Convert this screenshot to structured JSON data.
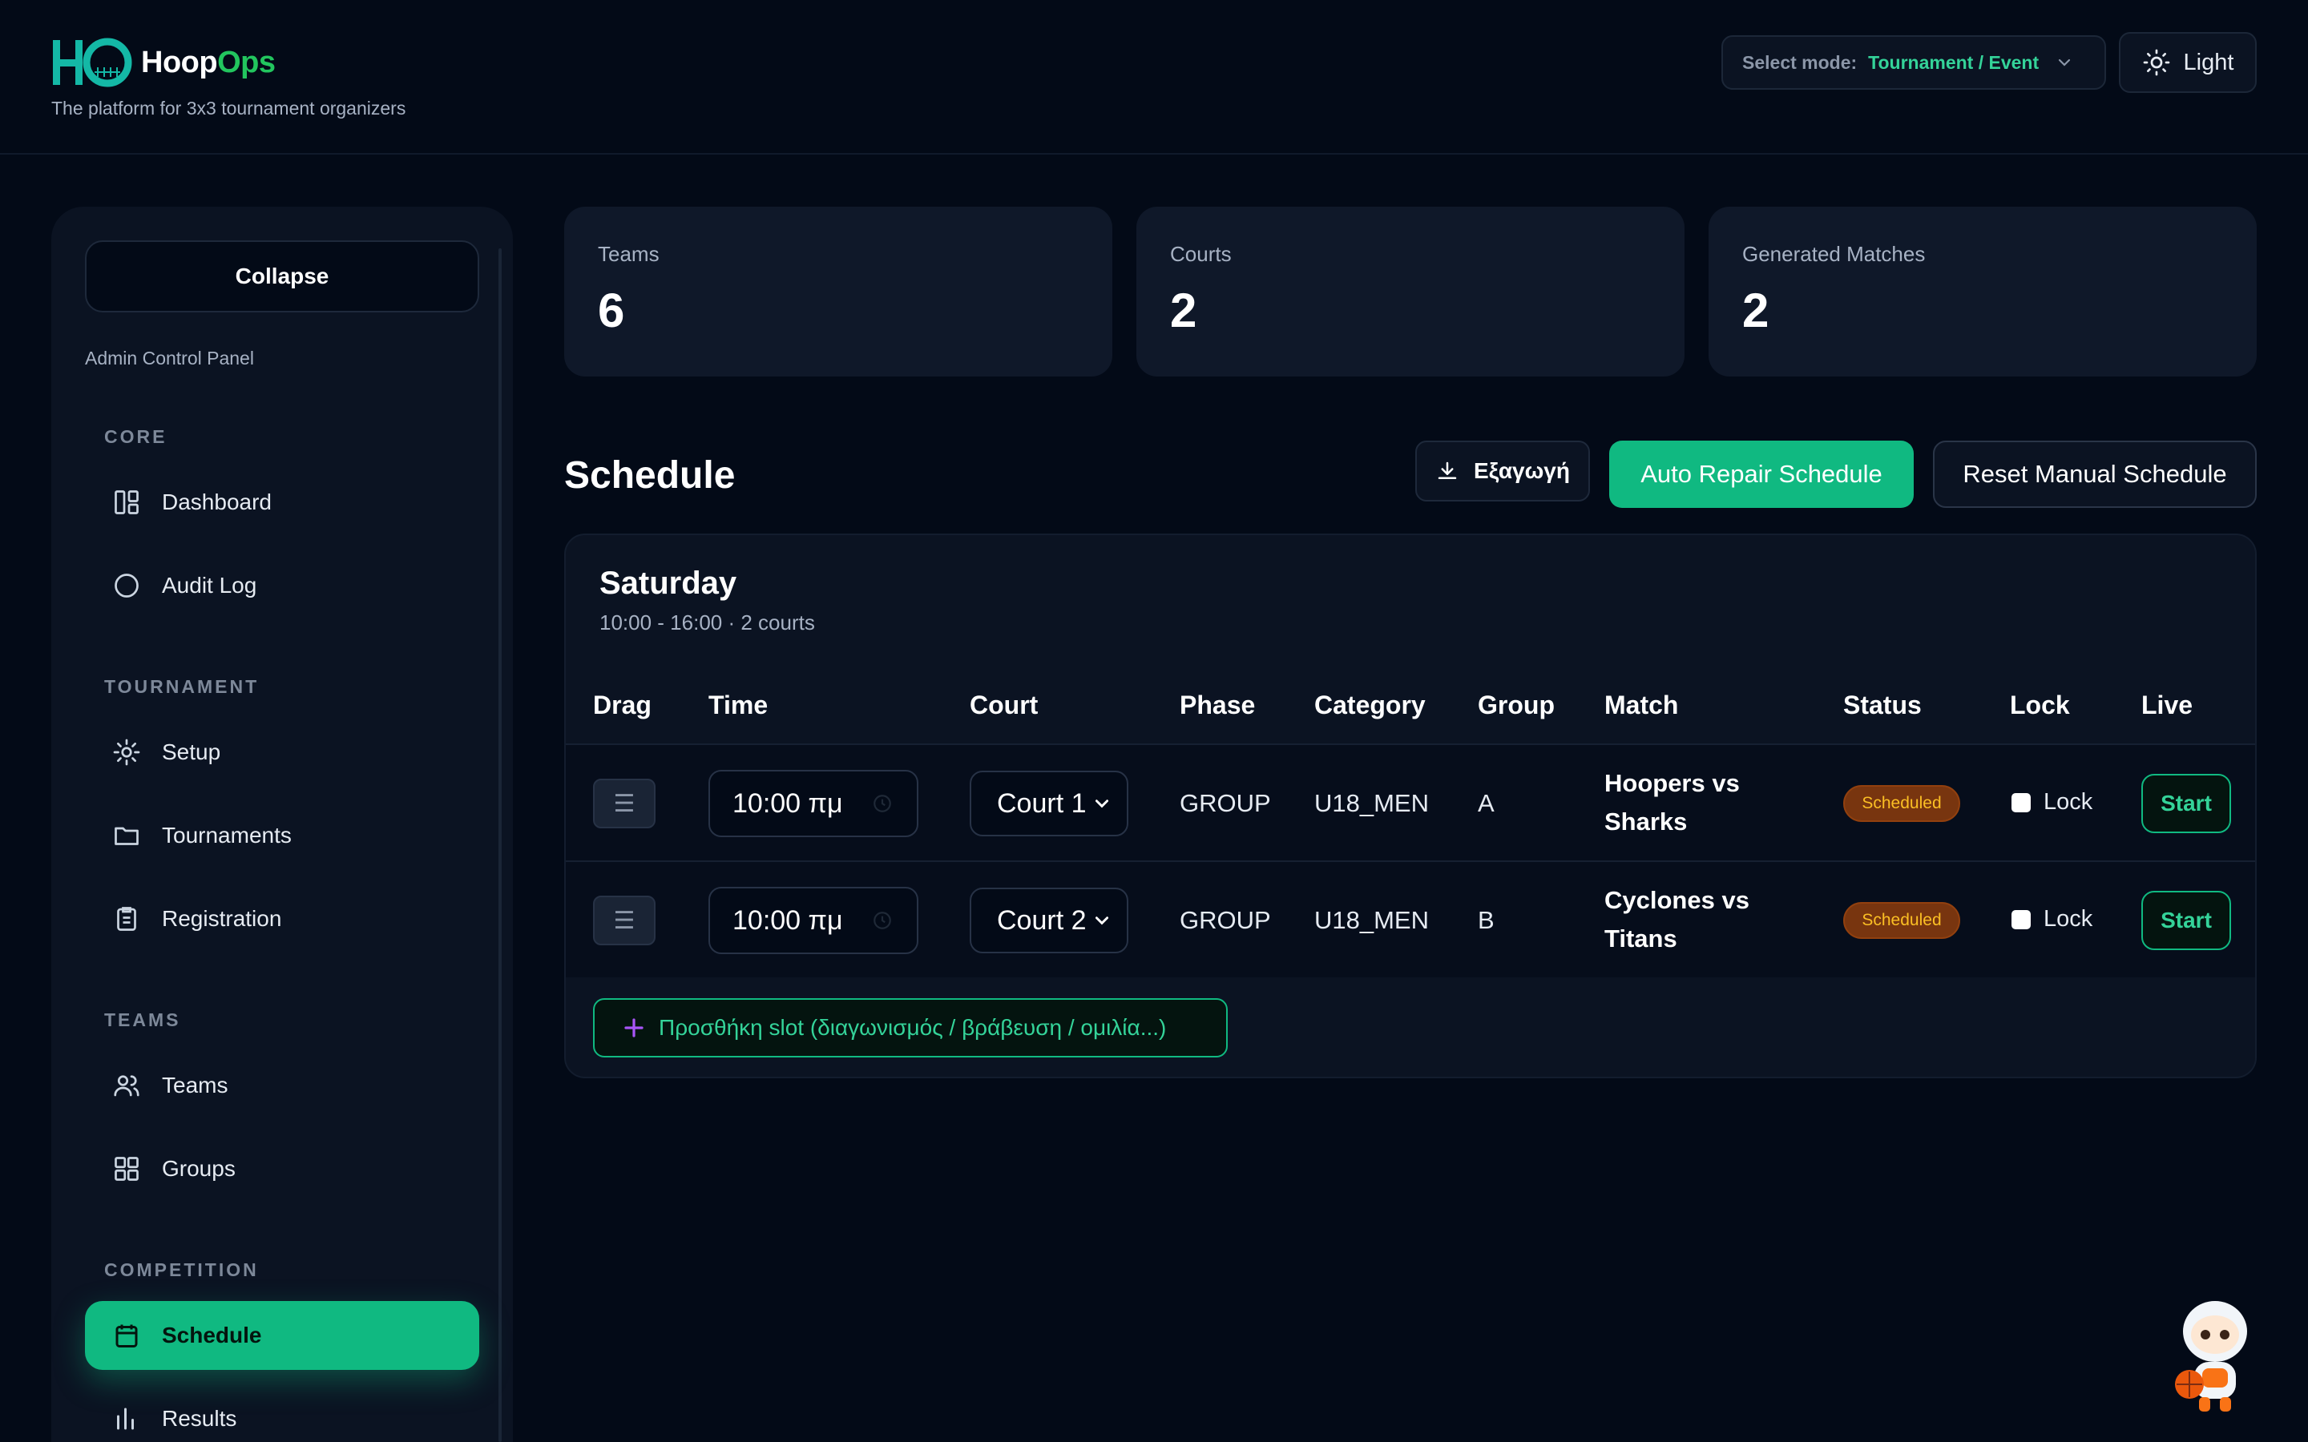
{
  "brand": {
    "name_part1": "Hoop",
    "name_part2": "Ops",
    "tagline": "The platform for 3x3 tournament organizers",
    "accent": "#22c55e"
  },
  "mode_select": {
    "label": "Select mode:",
    "value": "Tournament / Event"
  },
  "theme_toggle": {
    "label": "Light",
    "icon": "sun-icon"
  },
  "sidebar": {
    "collapse_label": "Collapse",
    "panel_label": "Admin Control Panel",
    "sections": {
      "core": "CORE",
      "tournament": "TOURNAMENT",
      "teams": "TEAMS",
      "competition": "COMPETITION"
    },
    "items": {
      "dashboard": "Dashboard",
      "audit_log": "Audit Log",
      "setup": "Setup",
      "tournaments": "Tournaments",
      "registration": "Registration",
      "teams": "Teams",
      "groups": "Groups",
      "schedule": "Schedule",
      "results": "Results"
    },
    "active_item": "schedule"
  },
  "stats": [
    {
      "label": "Teams",
      "value": "6"
    },
    {
      "label": "Courts",
      "value": "2"
    },
    {
      "label": "Generated Matches",
      "value": "2"
    }
  ],
  "schedule": {
    "title": "Schedule",
    "export_label": "Εξαγωγή",
    "auto_repair_label": "Auto Repair Schedule",
    "reset_label": "Reset Manual Schedule",
    "day": {
      "title": "Saturday",
      "subtitle": "10:00 - 16:00 · 2 courts"
    },
    "columns": {
      "drag": "Drag",
      "time": "Time",
      "court": "Court",
      "phase": "Phase",
      "category": "Category",
      "group": "Group",
      "match": "Match",
      "status": "Status",
      "lock": "Lock",
      "live": "Live"
    },
    "rows": [
      {
        "drag": "☰",
        "time": "10:00 πμ",
        "court": "Court 1",
        "phase": "GROUP",
        "category": "U18_MEN",
        "group": "A",
        "match_line1": "Hoopers vs",
        "match_line2": "Sharks",
        "status": "Scheduled",
        "lock": "Lock",
        "live": "Start"
      },
      {
        "drag": "☰",
        "time": "10:00 πμ",
        "court": "Court 2",
        "phase": "GROUP",
        "category": "U18_MEN",
        "group": "B",
        "match_line1": "Cyclones vs",
        "match_line2": "Titans",
        "status": "Scheduled",
        "lock": "Lock",
        "live": "Start"
      }
    ],
    "add_slot_label": "Προσθήκη slot (διαγωνισμός / βράβευση / ομιλία...)"
  }
}
